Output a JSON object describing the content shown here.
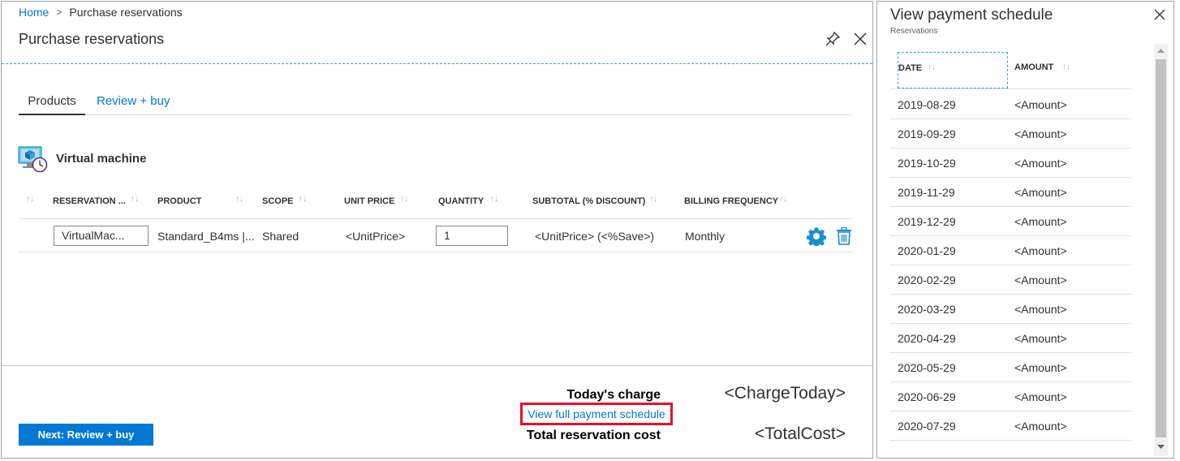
{
  "breadcrumb": {
    "home": "Home",
    "separator": ">",
    "current": "Purchase reservations"
  },
  "blade": {
    "title": "Purchase reservations"
  },
  "tabs": [
    {
      "label": "Products",
      "active": true
    },
    {
      "label": "Review + buy",
      "active": false
    }
  ],
  "section": {
    "title": "Virtual machine",
    "icon": "virtual-machine-clock-icon"
  },
  "table": {
    "headers": [
      "RESERVATION ...",
      "PRODUCT",
      "SCOPE",
      "UNIT PRICE",
      "QUANTITY",
      "SUBTOTAL (% DISCOUNT)",
      "BILLING FREQUENCY"
    ],
    "sort_glyph": "↑↓",
    "row": {
      "reservation_name": "VirtualMac...",
      "product": "Standard_B4ms |...",
      "scope": "Shared",
      "unit_price": "<UnitPrice>",
      "quantity": "1",
      "subtotal": "<UnitPrice> (<%Save>)",
      "billing_frequency": "Monthly"
    }
  },
  "footer": {
    "next_button": "Next: Review + buy",
    "todays_charge_label": "Today's charge",
    "todays_charge_value": "<ChargeToday>",
    "schedule_link": "View full payment schedule",
    "total_label": "Total reservation cost",
    "total_value": "<TotalCost>"
  },
  "payment_panel": {
    "title": "View payment schedule",
    "subtitle": "Reservations",
    "columns": {
      "date": "DATE",
      "amount": "AMOUNT"
    },
    "rows": [
      {
        "date": "2019-08-29",
        "amount": "<Amount>"
      },
      {
        "date": "2019-09-29",
        "amount": "<Amount>"
      },
      {
        "date": "2019-10-29",
        "amount": "<Amount>"
      },
      {
        "date": "2019-11-29",
        "amount": "<Amount>"
      },
      {
        "date": "2019-12-29",
        "amount": "<Amount>"
      },
      {
        "date": "2020-01-29",
        "amount": "<Amount>"
      },
      {
        "date": "2020-02-29",
        "amount": "<Amount>"
      },
      {
        "date": "2020-03-29",
        "amount": "<Amount>"
      },
      {
        "date": "2020-04-29",
        "amount": "<Amount>"
      },
      {
        "date": "2020-05-29",
        "amount": "<Amount>"
      },
      {
        "date": "2020-06-29",
        "amount": "<Amount>"
      },
      {
        "date": "2020-07-29",
        "amount": "<Amount>"
      }
    ]
  },
  "colors": {
    "accent": "#0078d4",
    "highlight_border": "#e81123",
    "icon_blue": "#1a8fce"
  }
}
